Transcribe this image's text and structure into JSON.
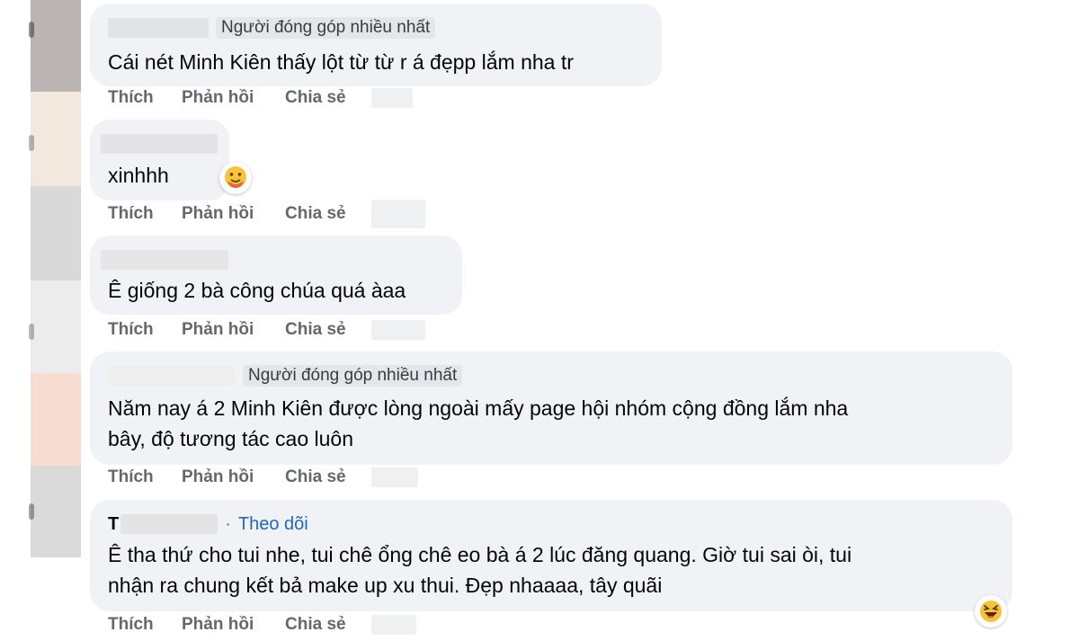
{
  "comments": [
    {
      "author_badge": "Người đóng góp nhiều nhất",
      "text": "Cái nét Minh Kiên thấy lột từ từ r á đẹpp lắm nha tr",
      "actions": {
        "like": "Thích",
        "reply": "Phản hồi",
        "share": "Chia sẻ"
      }
    },
    {
      "text": "xinhhh",
      "reaction_icon": "hug-emoji-icon",
      "actions": {
        "like": "Thích",
        "reply": "Phản hồi",
        "share": "Chia sẻ"
      }
    },
    {
      "text": "Ê giống 2 bà công chúa quá àaa",
      "actions": {
        "like": "Thích",
        "reply": "Phản hồi",
        "share": "Chia sẻ"
      }
    },
    {
      "author_badge": "Người đóng góp nhiều nhất",
      "text_lines": [
        "Năm nay á 2 Minh Kiên được lòng ngoài mấy page hội nhóm cộng đồng lắm nha",
        "bây, độ tương tác cao luôn"
      ],
      "actions": {
        "like": "Thích",
        "reply": "Phản hồi",
        "share": "Chia sẻ"
      }
    },
    {
      "author_initial": "T",
      "follow_label": "Theo dõi",
      "text_lines": [
        "Ê tha thứ cho tui nhe, tui chê ổng chê eo bà á 2 lúc đăng quang. Giờ tui sai òi, tui",
        "nhận ra chung kết bả make up xu thui. Đẹp nhaaaa, tây quãi"
      ],
      "reaction_icon": "laughing-emoji-icon",
      "actions": {
        "like": "Thích",
        "reply": "Phản hồi",
        "share": "Chia sẻ"
      }
    }
  ],
  "colors": {
    "bubble": "#f0f2f5",
    "action_text": "#65676b",
    "follow_link": "#1f66c6"
  }
}
